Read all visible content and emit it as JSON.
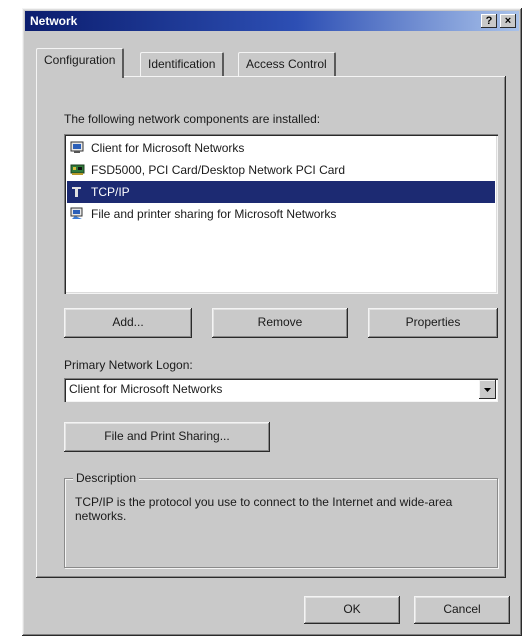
{
  "window": {
    "title": "Network",
    "help_button": "?",
    "close_button": "×"
  },
  "tabs": [
    {
      "label": "Configuration",
      "active": true
    },
    {
      "label": "Identification",
      "active": false
    },
    {
      "label": "Access Control",
      "active": false
    }
  ],
  "components": {
    "label": "The following network components are installed:",
    "items": [
      {
        "label": "Client for Microsoft Networks",
        "icon": "network-client-icon",
        "selected": false
      },
      {
        "label": "FSD5000, PCI Card/Desktop Network PCI Card",
        "icon": "network-adapter-icon",
        "selected": false
      },
      {
        "label": "TCP/IP",
        "icon": "protocol-icon",
        "selected": true
      },
      {
        "label": "File and printer sharing for Microsoft Networks",
        "icon": "file-sharing-icon",
        "selected": false
      }
    ]
  },
  "buttons": {
    "add": "Add...",
    "remove": "Remove",
    "properties": "Properties",
    "file_print_sharing": "File and Print Sharing...",
    "ok": "OK",
    "cancel": "Cancel"
  },
  "logon": {
    "label": "Primary Network Logon:",
    "value": "Client for Microsoft Networks"
  },
  "description": {
    "legend": "Description",
    "text": "TCP/IP is the protocol you use to connect to the Internet and wide-area networks."
  },
  "colors": {
    "title_start": "#0b1d6e",
    "title_end": "#a9c2ea",
    "selection": "#1c2a72",
    "face": "#c9c9c9"
  }
}
